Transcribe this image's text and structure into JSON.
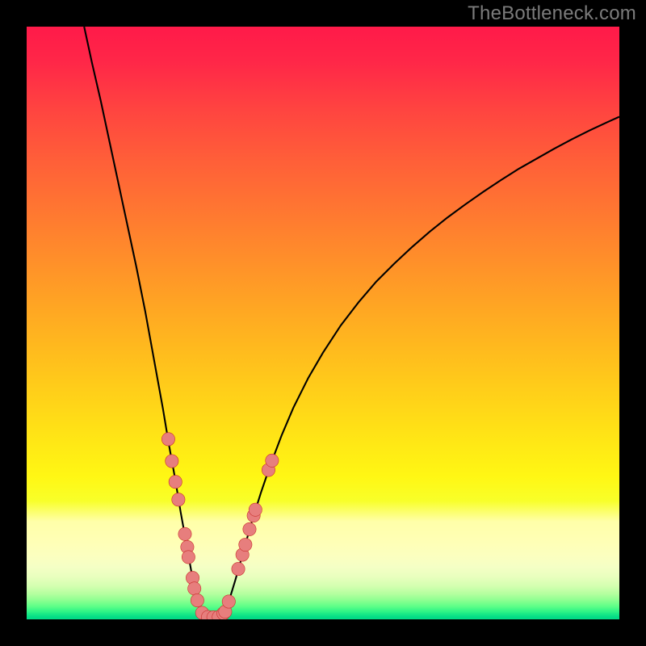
{
  "watermark": "TheBottleneck.com",
  "colors": {
    "frame": "#000000",
    "curve": "#000000",
    "dot_fill": "#e77e7d",
    "dot_stroke": "#c9302c",
    "grad_stops": [
      {
        "o": 0.0,
        "c": "#ff1a49"
      },
      {
        "o": 0.06,
        "c": "#ff2748"
      },
      {
        "o": 0.14,
        "c": "#ff4440"
      },
      {
        "o": 0.22,
        "c": "#ff5d39"
      },
      {
        "o": 0.3,
        "c": "#ff7432"
      },
      {
        "o": 0.38,
        "c": "#ff8b2b"
      },
      {
        "o": 0.46,
        "c": "#ffa224"
      },
      {
        "o": 0.54,
        "c": "#ffb91e"
      },
      {
        "o": 0.62,
        "c": "#ffd019"
      },
      {
        "o": 0.7,
        "c": "#ffe715"
      },
      {
        "o": 0.76,
        "c": "#fff714"
      },
      {
        "o": 0.8,
        "c": "#f8ff29"
      },
      {
        "o": 0.835,
        "c": "#ffffa9"
      },
      {
        "o": 0.865,
        "c": "#ffffb4"
      },
      {
        "o": 0.895,
        "c": "#fbffc0"
      },
      {
        "o": 0.912,
        "c": "#f4ffc5"
      },
      {
        "o": 0.928,
        "c": "#e9ffbe"
      },
      {
        "o": 0.944,
        "c": "#d3ffb0"
      },
      {
        "o": 0.957,
        "c": "#b4ff9f"
      },
      {
        "o": 0.968,
        "c": "#8cff91"
      },
      {
        "o": 0.978,
        "c": "#5eff88"
      },
      {
        "o": 0.986,
        "c": "#33f586"
      },
      {
        "o": 0.992,
        "c": "#14e786"
      },
      {
        "o": 0.996,
        "c": "#05dd86"
      },
      {
        "o": 1.0,
        "c": "#02d985"
      }
    ]
  },
  "chart_data": {
    "type": "line",
    "title": "",
    "xlabel": "",
    "ylabel": "",
    "xlim": [
      0,
      100
    ],
    "ylim": [
      0,
      100
    ],
    "curve": [
      {
        "x": 9.7,
        "y": 100.0
      },
      {
        "x": 11.0,
        "y": 94.0
      },
      {
        "x": 12.5,
        "y": 87.5
      },
      {
        "x": 14.0,
        "y": 80.5
      },
      {
        "x": 15.5,
        "y": 73.5
      },
      {
        "x": 17.0,
        "y": 66.5
      },
      {
        "x": 18.5,
        "y": 59.5
      },
      {
        "x": 20.0,
        "y": 52.0
      },
      {
        "x": 21.0,
        "y": 46.5
      },
      {
        "x": 22.0,
        "y": 41.0
      },
      {
        "x": 23.0,
        "y": 35.5
      },
      {
        "x": 24.0,
        "y": 29.5
      },
      {
        "x": 25.0,
        "y": 24.0
      },
      {
        "x": 26.0,
        "y": 18.0
      },
      {
        "x": 27.0,
        "y": 12.5
      },
      {
        "x": 27.8,
        "y": 8.0
      },
      {
        "x": 28.5,
        "y": 4.6
      },
      {
        "x": 29.2,
        "y": 2.2
      },
      {
        "x": 30.0,
        "y": 0.9
      },
      {
        "x": 31.0,
        "y": 0.25
      },
      {
        "x": 32.0,
        "y": 0.25
      },
      {
        "x": 33.0,
        "y": 0.9
      },
      {
        "x": 33.8,
        "y": 2.2
      },
      {
        "x": 34.5,
        "y": 4.3
      },
      {
        "x": 35.2,
        "y": 6.6
      },
      {
        "x": 36.0,
        "y": 9.4
      },
      {
        "x": 37.0,
        "y": 13.0
      },
      {
        "x": 38.0,
        "y": 16.5
      },
      {
        "x": 39.5,
        "y": 21.3
      },
      {
        "x": 41.0,
        "y": 25.7
      },
      {
        "x": 43.0,
        "y": 31.0
      },
      {
        "x": 45.0,
        "y": 35.7
      },
      {
        "x": 47.5,
        "y": 40.7
      },
      {
        "x": 50.0,
        "y": 45.0
      },
      {
        "x": 53.0,
        "y": 49.6
      },
      {
        "x": 56.0,
        "y": 53.5
      },
      {
        "x": 59.0,
        "y": 57.0
      },
      {
        "x": 62.0,
        "y": 60.0
      },
      {
        "x": 65.0,
        "y": 62.8
      },
      {
        "x": 68.0,
        "y": 65.4
      },
      {
        "x": 71.0,
        "y": 67.8
      },
      {
        "x": 74.0,
        "y": 70.0
      },
      {
        "x": 77.0,
        "y": 72.1
      },
      {
        "x": 80.0,
        "y": 74.1
      },
      {
        "x": 83.0,
        "y": 76.0
      },
      {
        "x": 86.0,
        "y": 77.7
      },
      {
        "x": 89.0,
        "y": 79.4
      },
      {
        "x": 92.0,
        "y": 81.0
      },
      {
        "x": 95.0,
        "y": 82.5
      },
      {
        "x": 98.0,
        "y": 83.9
      },
      {
        "x": 100.0,
        "y": 84.8
      }
    ],
    "dots": [
      {
        "x": 23.9,
        "y": 30.4
      },
      {
        "x": 24.5,
        "y": 26.7
      },
      {
        "x": 25.1,
        "y": 23.2
      },
      {
        "x": 25.6,
        "y": 20.2
      },
      {
        "x": 26.7,
        "y": 14.4
      },
      {
        "x": 27.1,
        "y": 12.2
      },
      {
        "x": 27.3,
        "y": 10.5
      },
      {
        "x": 28.0,
        "y": 7.0
      },
      {
        "x": 28.3,
        "y": 5.2
      },
      {
        "x": 28.8,
        "y": 3.2
      },
      {
        "x": 29.6,
        "y": 1.1
      },
      {
        "x": 30.6,
        "y": 0.4
      },
      {
        "x": 31.5,
        "y": 0.35
      },
      {
        "x": 32.4,
        "y": 0.4
      },
      {
        "x": 33.2,
        "y": 1.0
      },
      {
        "x": 33.5,
        "y": 1.3
      },
      {
        "x": 34.1,
        "y": 3.0
      },
      {
        "x": 35.7,
        "y": 8.5
      },
      {
        "x": 36.4,
        "y": 10.9
      },
      {
        "x": 36.9,
        "y": 12.6
      },
      {
        "x": 37.6,
        "y": 15.2
      },
      {
        "x": 38.3,
        "y": 17.5
      },
      {
        "x": 38.6,
        "y": 18.5
      },
      {
        "x": 40.8,
        "y": 25.2
      },
      {
        "x": 41.4,
        "y": 26.8
      }
    ],
    "dot_radius_units": 1.11
  }
}
